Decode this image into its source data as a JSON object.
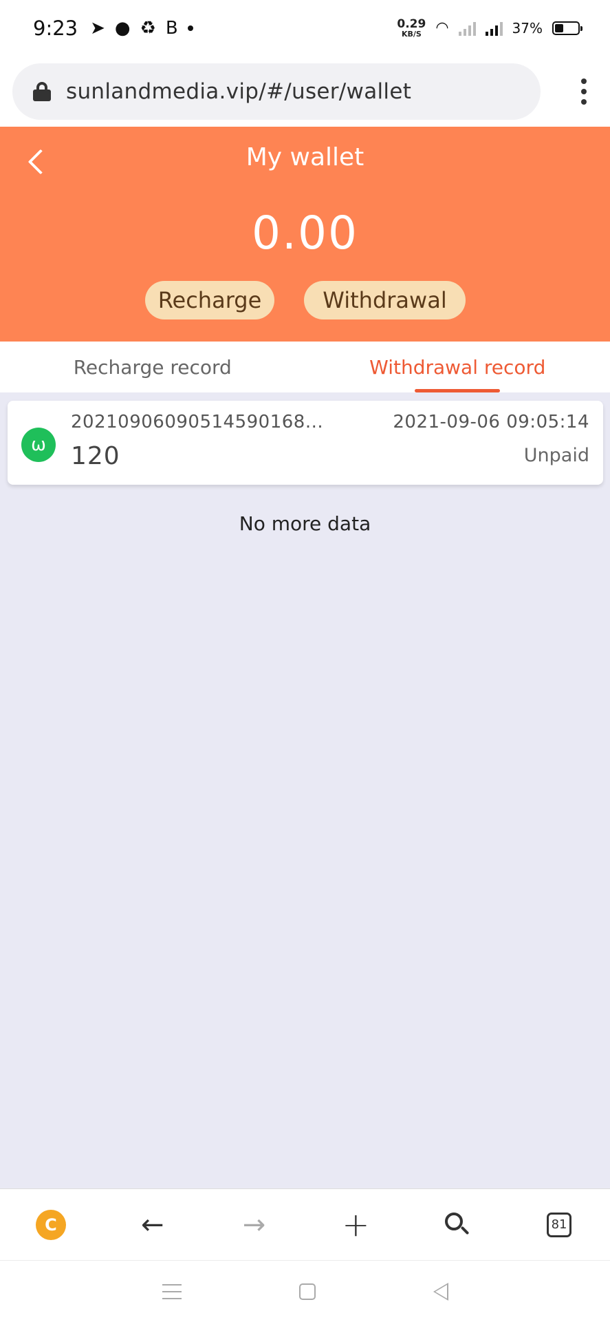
{
  "status_bar": {
    "time": "9:23",
    "letter": "B",
    "net_speed_value": "0.29",
    "net_speed_unit": "KB/S",
    "battery": "37%",
    "battery_level": 0.37
  },
  "browser": {
    "url": "sunlandmedia.vip/#/user/wallet"
  },
  "wallet": {
    "title": "My wallet",
    "balance": "0.00",
    "recharge_label": "Recharge",
    "withdrawal_label": "Withdrawal"
  },
  "tabs": [
    {
      "label": "Recharge record",
      "active": false
    },
    {
      "label": "Withdrawal record",
      "active": true
    }
  ],
  "records": [
    {
      "icon_letter": "ω",
      "id": "20210906090514590168...",
      "time": "2021-09-06 09:05:14",
      "amount": "120",
      "status": "Unpaid"
    }
  ],
  "list_footer": "No more data",
  "toolbar": {
    "tab_count": "81",
    "coin_letter": "C"
  },
  "colors": {
    "header": "#fe8453",
    "accent": "#ee5a34",
    "button_bg": "#f8deb4",
    "record_icon": "#1fbf5a",
    "page_bg": "#e9e9f4"
  }
}
